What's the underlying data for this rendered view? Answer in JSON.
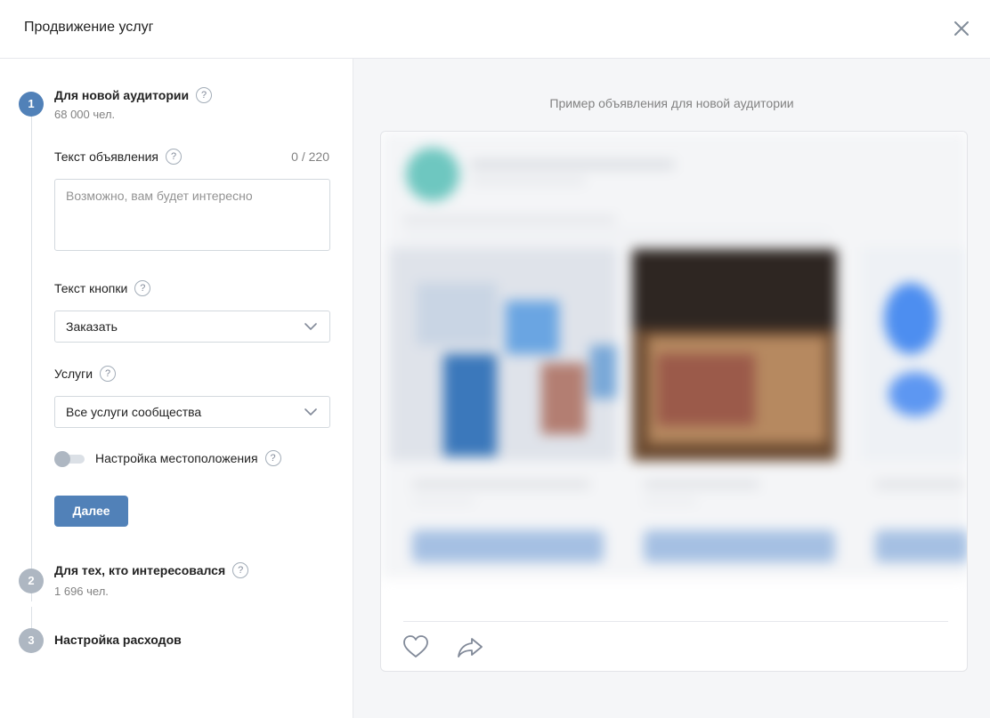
{
  "modal": {
    "title": "Продвижение услуг",
    "close_icon": "close-icon"
  },
  "steps": [
    {
      "number": "1",
      "title": "Для новой аудитории",
      "subtitle": "68 000 чел.",
      "state": "active"
    },
    {
      "number": "2",
      "title": "Для тех, кто интересовался",
      "subtitle": "1 696 чел.",
      "state": "inactive"
    },
    {
      "number": "3",
      "title": "Настройка расходов",
      "state": "inactive"
    }
  ],
  "form": {
    "ad_text": {
      "label": "Текст объявления",
      "counter": "0 / 220",
      "value": "",
      "placeholder": "Возможно, вам будет интересно"
    },
    "button_text": {
      "label": "Текст кнопки",
      "selected": "Заказать"
    },
    "services": {
      "label": "Услуги",
      "selected": "Все услуги сообщества"
    },
    "location": {
      "label": "Настройка местоположения",
      "enabled": false
    },
    "next_button": "Далее",
    "help_glyph": "?"
  },
  "preview": {
    "title": "Пример объявления для новой аудитории",
    "actions": [
      "heart-icon",
      "share-icon"
    ]
  },
  "colors": {
    "accent": "#5181b8",
    "step_inactive": "#aeb7c2",
    "panel_bg": "#f5f6f8",
    "border": "#d3d9de"
  }
}
